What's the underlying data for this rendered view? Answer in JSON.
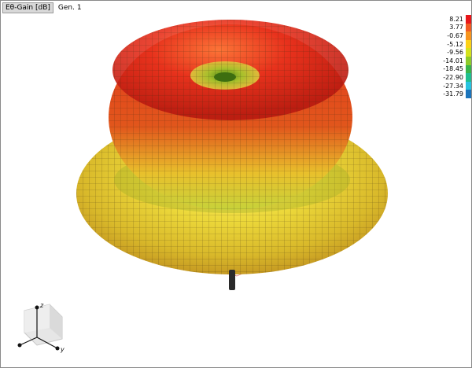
{
  "header": {
    "quantity_tab": "Eθ-Gain [dB]",
    "generation": "Gen. 1"
  },
  "legend": {
    "entries": [
      {
        "value": "8.21",
        "color": "#e8161a"
      },
      {
        "value": "3.77",
        "color": "#f15a22"
      },
      {
        "value": "-0.67",
        "color": "#f7941d"
      },
      {
        "value": "-5.12",
        "color": "#fcd116"
      },
      {
        "value": "-9.56",
        "color": "#d4e21c"
      },
      {
        "value": "-14.01",
        "color": "#8ecb2a"
      },
      {
        "value": "-18.45",
        "color": "#39b54a"
      },
      {
        "value": "-22.90",
        "color": "#1fbf8f"
      },
      {
        "value": "-27.34",
        "color": "#27c3e0"
      },
      {
        "value": "-31.79",
        "color": "#1c75bc"
      }
    ]
  },
  "gizmo": {
    "z_label": "z",
    "y_label": "y"
  },
  "colors": {
    "upper_lobe_high": "#e8241a",
    "lower_lobe": "#e6d630",
    "mesh_line": "#3a2a10"
  }
}
